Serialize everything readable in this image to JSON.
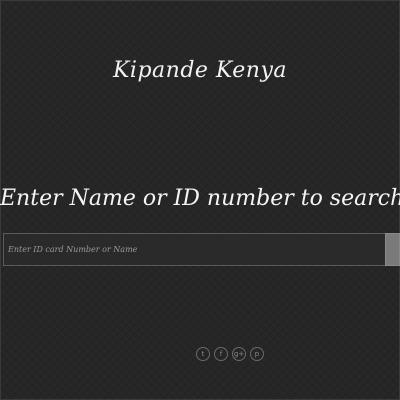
{
  "header": {
    "site_title": "Kipande Kenya"
  },
  "main": {
    "heading": "Enter Name or ID number to search",
    "search": {
      "placeholder": "Enter ID card Number or Name",
      "value": ""
    }
  },
  "footer": {
    "social": [
      {
        "icon": "twitter-icon",
        "glyph": "t"
      },
      {
        "icon": "facebook-icon",
        "glyph": "f"
      },
      {
        "icon": "google-plus-icon",
        "glyph": "g+"
      },
      {
        "icon": "pinterest-icon",
        "glyph": "p"
      }
    ]
  },
  "colors": {
    "background": "#262626",
    "text": "#f2f2f2",
    "search_button": "#7a7a7a"
  }
}
